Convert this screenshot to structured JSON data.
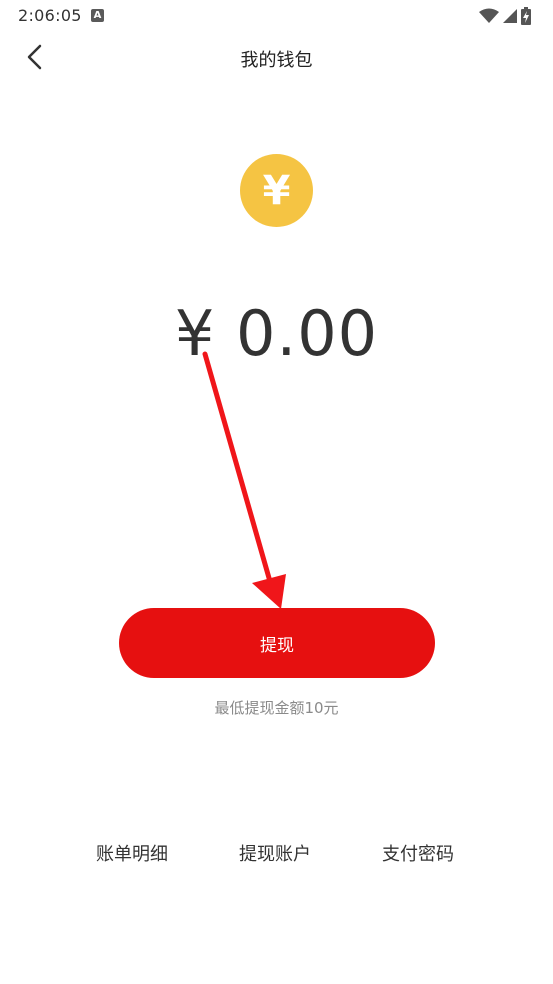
{
  "status_bar": {
    "time": "2:06:05",
    "notification_icon": "A",
    "icons": [
      "wifi-icon",
      "signal-icon",
      "battery-charging-icon"
    ]
  },
  "header": {
    "title": "我的钱包",
    "back_icon": "chevron-left-icon"
  },
  "wallet": {
    "coin_symbol": "¥",
    "balance": "¥ 0.00"
  },
  "actions": {
    "withdraw_label": "提现",
    "min_note": "最低提现金额10元"
  },
  "bottom_links": {
    "bill_details": "账单明细",
    "withdraw_account": "提现账户",
    "payment_password": "支付密码"
  },
  "colors": {
    "accent": "#e61010",
    "coin": "#f5c443",
    "annotation_arrow": "#f0161a"
  }
}
